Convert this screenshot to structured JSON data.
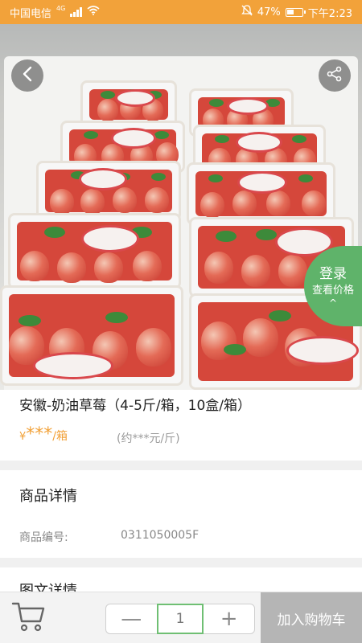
{
  "status_bar": {
    "carrier": "中国电信",
    "network": "4G",
    "battery": "47%",
    "battery_level": 0.47,
    "time": "下午2:23",
    "icons": [
      "signal-icon",
      "wifi-icon",
      "mute-icon",
      "battery-icon"
    ]
  },
  "hero": {
    "icons": {
      "back": "chevron-left-icon",
      "share": "share-icon"
    }
  },
  "login_float": {
    "line1": "登录",
    "line2": "查看价格",
    "chevron": "^"
  },
  "product": {
    "title": "安徽-奶油草莓（4-5斤/箱，10盒/箱）",
    "price_currency": "¥",
    "price_stars": "***",
    "price_unit": "/箱",
    "approx_price": "(约***元/斤)"
  },
  "details": {
    "section_title": "商品详情",
    "code_label": "商品编号:",
    "code_value": "0311050005F"
  },
  "graphic_details": {
    "section_title": "图文详情"
  },
  "bottom_bar": {
    "quantity": "1",
    "minus": "—",
    "plus": "+",
    "add_to_cart": "加入购物车",
    "icons": {
      "cart": "cart-icon"
    }
  },
  "colors": {
    "accent": "#f2a23a",
    "login_green": "#5fb36a",
    "stepper_green": "#6fbf73",
    "add_cart_gray": "#b5b5b5"
  }
}
